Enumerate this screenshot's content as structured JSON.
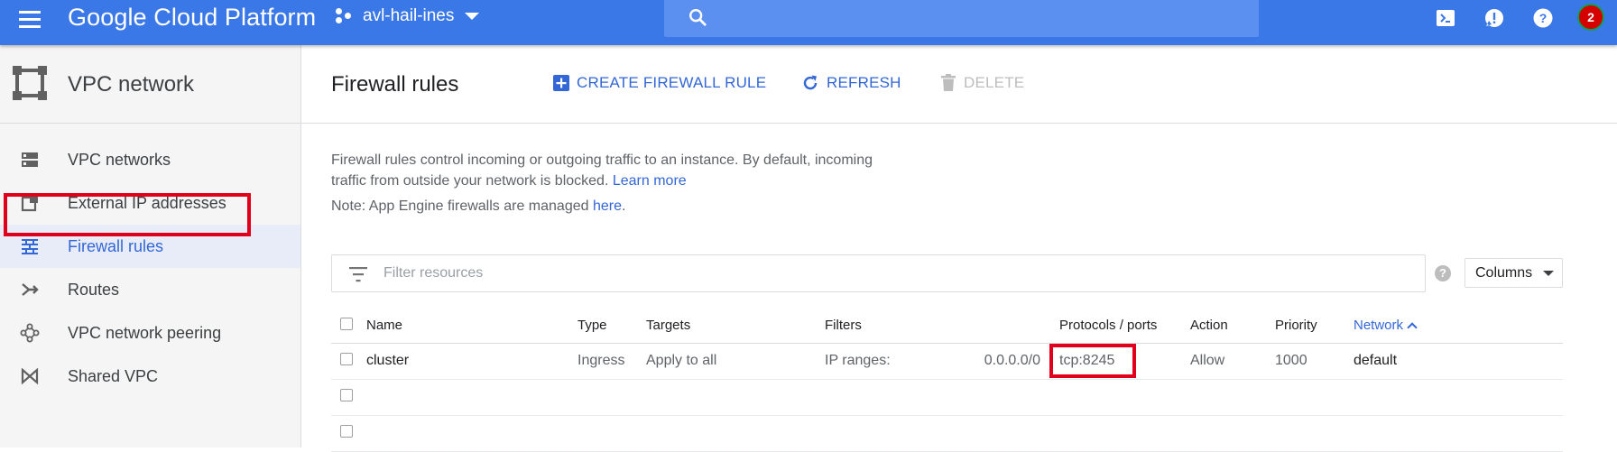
{
  "topbar": {
    "brand": "Google Cloud Platform",
    "project": "avl-hail-ines",
    "notification_count": "2",
    "colors": {
      "bar": "#3b78e7",
      "search": "#5b8ff0",
      "badge": "#d50000",
      "badge_ring": "#0f9d58"
    }
  },
  "sidebar": {
    "title": "VPC network",
    "items": [
      {
        "label": "VPC networks",
        "icon": "vpc-networks-icon"
      },
      {
        "label": "External IP addresses",
        "icon": "external-ip-icon"
      },
      {
        "label": "Firewall rules",
        "icon": "firewall-icon",
        "active": true
      },
      {
        "label": "Routes",
        "icon": "routes-icon"
      },
      {
        "label": "VPC network peering",
        "icon": "peering-icon"
      },
      {
        "label": "Shared VPC",
        "icon": "shared-vpc-icon"
      }
    ]
  },
  "main": {
    "title": "Firewall rules",
    "toolbar": {
      "create_label": "CREATE FIREWALL RULE",
      "refresh_label": "REFRESH",
      "delete_label": "DELETE"
    },
    "description_text": "Firewall rules control incoming or outgoing traffic to an instance. By default, incoming traffic from outside your network is blocked.",
    "learn_more": "Learn more",
    "note_text": "Note: App Engine firewalls are managed",
    "note_link": "here",
    "note_end": ".",
    "filter_placeholder": "Filter resources",
    "help": "?",
    "columns_label": "Columns",
    "table": {
      "headers": {
        "name": "Name",
        "type": "Type",
        "targets": "Targets",
        "filters": "Filters",
        "protocols": "Protocols / ports",
        "action": "Action",
        "priority": "Priority",
        "network": "Network"
      },
      "rows": [
        {
          "name": "cluster",
          "type": "Ingress",
          "targets": "Apply to all",
          "filters_label": "IP ranges:",
          "filters_value": "0.0.0.0/0",
          "protocols": "tcp:8245",
          "action": "Allow",
          "priority": "1000",
          "network": "default"
        }
      ]
    }
  }
}
